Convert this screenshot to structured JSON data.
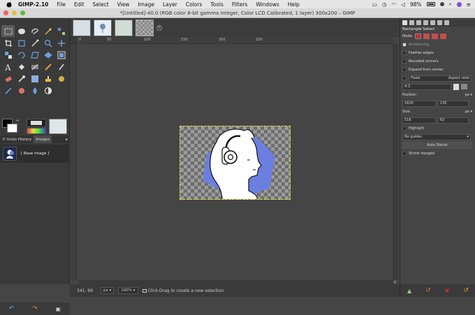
{
  "menubar": {
    "app": "GIMP-2.10",
    "items": [
      "File",
      "Edit",
      "Select",
      "View",
      "Image",
      "Layer",
      "Colors",
      "Tools",
      "Filters",
      "Windows",
      "Help"
    ],
    "battery": "98%"
  },
  "window": {
    "title": "*[Untitled]-40.0 (RGB color 8-bit gamma integer, Color LCD Calibrated, 1 layer) 300x200 – GIMP"
  },
  "dock": {
    "tab_history": "Undo History",
    "tab_images": "Images",
    "history_item": "[ Base Image ]"
  },
  "ruler": {
    "t0": "0",
    "t1": "50",
    "t2": "100",
    "t3": "150",
    "t4": "200",
    "t5": "250"
  },
  "status": {
    "coords": "341, 99",
    "unit": "px",
    "zoom": "100%",
    "message": "Click-Drag to create a new selection"
  },
  "tool_options": {
    "tool": "Rectangle Select",
    "mode_label": "Mode:",
    "antialiasing": "Antialiasing",
    "feather": "Feather edges",
    "rounded": "Rounded corners",
    "expand": "Expand from center",
    "fixed": "Fixed",
    "aspect": "Aspect ratio",
    "ratio": "4:3",
    "position_label": "Position:",
    "pos_unit": "px",
    "pos_x": "1620",
    "pos_y": "135",
    "size_label": "Size:",
    "size_unit": "px",
    "size_w": "516",
    "size_h": "63",
    "highlight": "Highlight",
    "guides": "No guides",
    "autoshrink": "Auto Shrink",
    "shrink_merged": "Shrink merged"
  },
  "colors": {
    "accent": "#e8e820",
    "figure_blue": "#6b7fe0"
  }
}
